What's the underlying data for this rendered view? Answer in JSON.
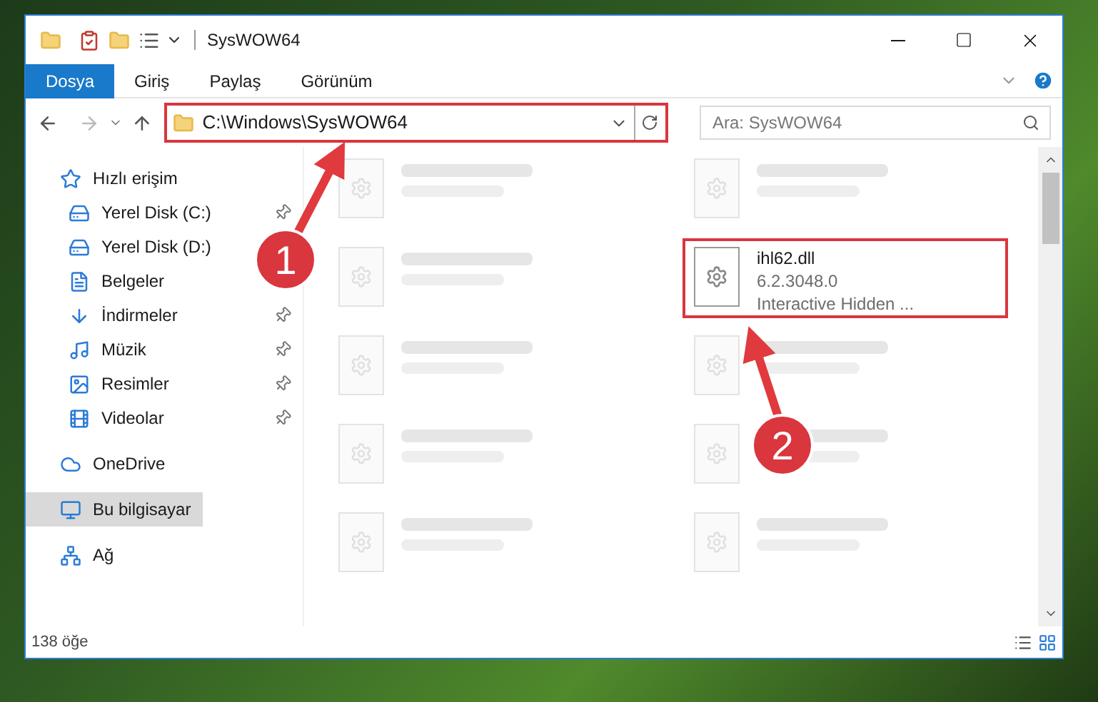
{
  "window": {
    "title": "SysWOW64"
  },
  "ribbon_tabs": [
    {
      "label": "Dosya",
      "selected": true
    },
    {
      "label": "Giriş",
      "selected": false
    },
    {
      "label": "Paylaş",
      "selected": false
    },
    {
      "label": "Görünüm",
      "selected": false
    }
  ],
  "address": {
    "value": "C:\\Windows\\SysWOW64",
    "highlighted": true
  },
  "search": {
    "placeholder": "Ara: SysWOW64"
  },
  "sidebar": {
    "items": [
      {
        "label": "Hızlı erişim",
        "selected": false,
        "children": [
          {
            "label": "Yerel Disk (C:)",
            "pinned": true,
            "selected": false
          },
          {
            "label": "Yerel Disk (D:)",
            "selected": false
          },
          {
            "label": "Belgeler",
            "selected": false
          },
          {
            "label": "İndirmeler",
            "pinned": true,
            "selected": false
          },
          {
            "label": "Müzik",
            "pinned": true,
            "selected": false
          },
          {
            "label": "Resimler",
            "pinned": true,
            "selected": false
          },
          {
            "label": "Videolar",
            "pinned": true,
            "selected": false
          }
        ]
      },
      {
        "label": "OneDrive",
        "selected": false
      },
      {
        "label": "Bu bilgisayar",
        "selected": true
      },
      {
        "label": "Ağ",
        "selected": false
      }
    ]
  },
  "files": [
    {
      "kind": "blurred"
    },
    {
      "kind": "blurred"
    },
    {
      "kind": "blurred"
    },
    {
      "kind": "file",
      "name": "ihl62.dll",
      "details": [
        "6.2.3048.0",
        "Interactive Hidden ..."
      ],
      "highlighted": true
    },
    {
      "kind": "blurred"
    },
    {
      "kind": "blurred"
    },
    {
      "kind": "blurred"
    },
    {
      "kind": "blurred"
    },
    {
      "kind": "blurred"
    },
    {
      "kind": "blurred"
    }
  ],
  "status_bar": {
    "count": "138 öğe"
  },
  "annotations": [
    {
      "label": "1"
    },
    {
      "label": "2"
    }
  ]
}
